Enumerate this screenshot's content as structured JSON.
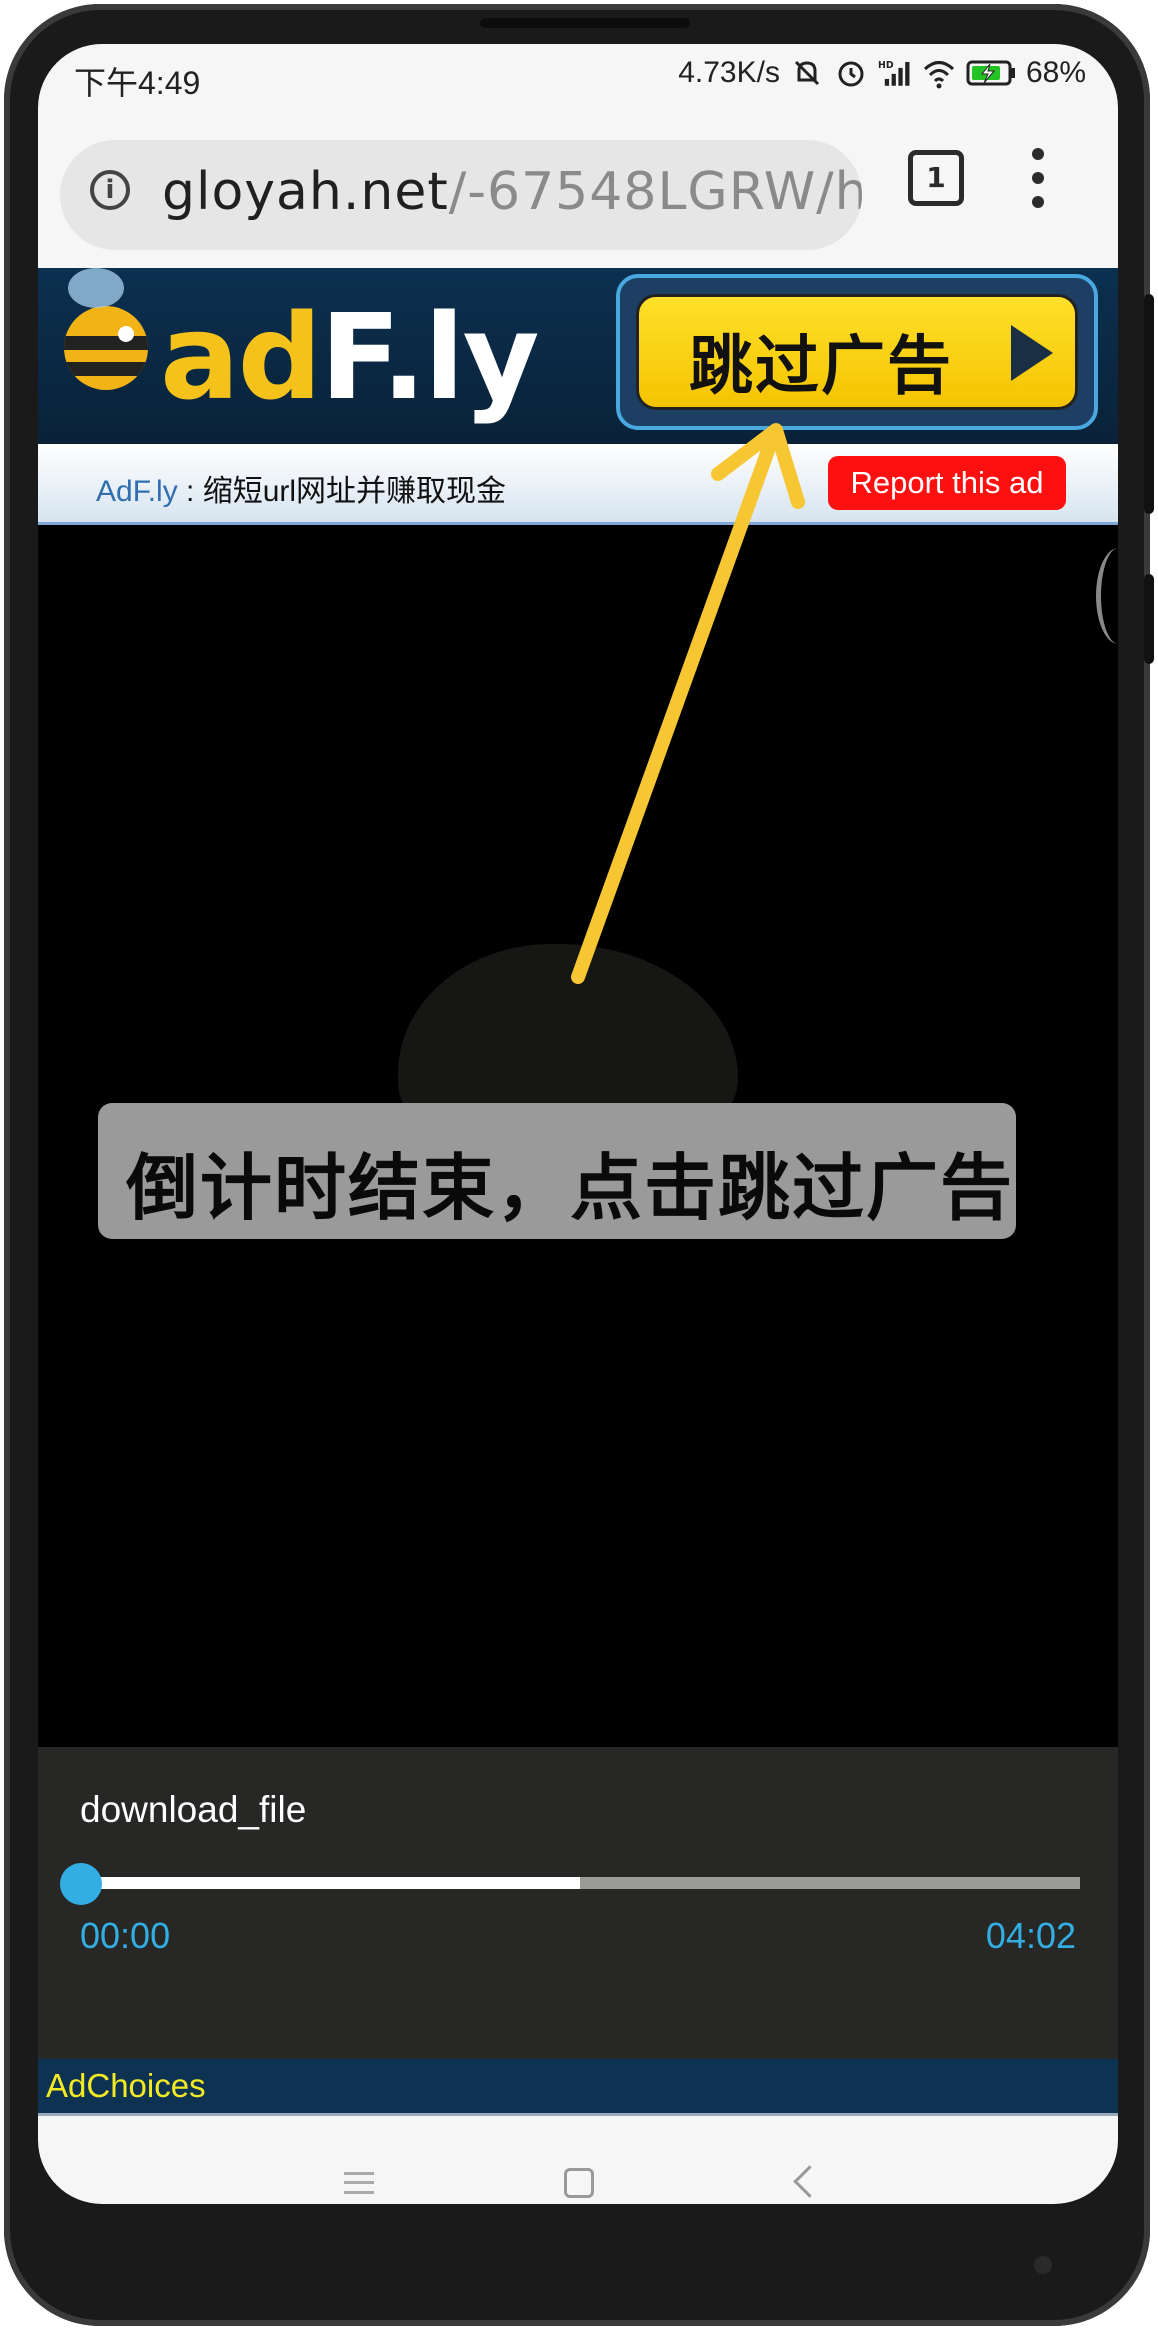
{
  "status_bar": {
    "time": "下午4:49",
    "net_speed": "4.73K/s",
    "signal_tag": "HD",
    "battery": "68%"
  },
  "browser": {
    "url_host": "gloyah.net",
    "url_path": "/-67548LGRW/h",
    "tab_count": "1"
  },
  "ad_header": {
    "logo_ad": "ad",
    "logo_fly": "F.ly",
    "skip_label": "跳过广告"
  },
  "subheader": {
    "brand": "AdF.ly",
    "tagline": " : 缩短url网址并赚取现金",
    "report_label": "Report this ad"
  },
  "annotation": {
    "caption": "倒计时结束，点击跳过广告",
    "arrow_color": "#f7c633"
  },
  "player": {
    "file_name": "download_file",
    "current_time": "00:00",
    "total_time": "04:02",
    "buffered_fraction": 0.5,
    "played_fraction": 0.0,
    "accent_color": "#33aee3"
  },
  "footer": {
    "adchoices": "AdChoices"
  },
  "icons": [
    "info-icon",
    "tabs-icon",
    "more-vert-icon",
    "mute-bell-icon",
    "alarm-icon",
    "signal-icon",
    "wifi-icon",
    "battery-icon",
    "play-icon",
    "nav-menu-icon",
    "nav-home-icon",
    "nav-back-icon"
  ]
}
